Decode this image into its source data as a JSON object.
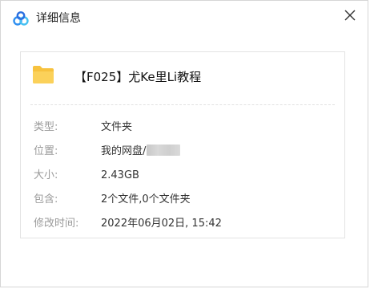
{
  "window": {
    "title": "详细信息",
    "app_icon": "baidu-netdisk-logo-icon",
    "close_icon": "close-icon"
  },
  "file": {
    "icon": "folder-icon",
    "name": "【F025】尤Ke里Li教程"
  },
  "details": [
    {
      "label": "类型:",
      "value": "文件夹"
    },
    {
      "label": "位置:",
      "value": "我的网盘/"
    },
    {
      "label": "大小:",
      "value": "2.43GB"
    },
    {
      "label": "包含:",
      "value": "2个文件,0个文件夹"
    },
    {
      "label": "修改时间:",
      "value": "2022年06月02日, 15:42"
    }
  ],
  "colors": {
    "folder": "#f7c23e",
    "logo_blue": "#2f8ff0",
    "label_gray": "#9a9a9a"
  }
}
